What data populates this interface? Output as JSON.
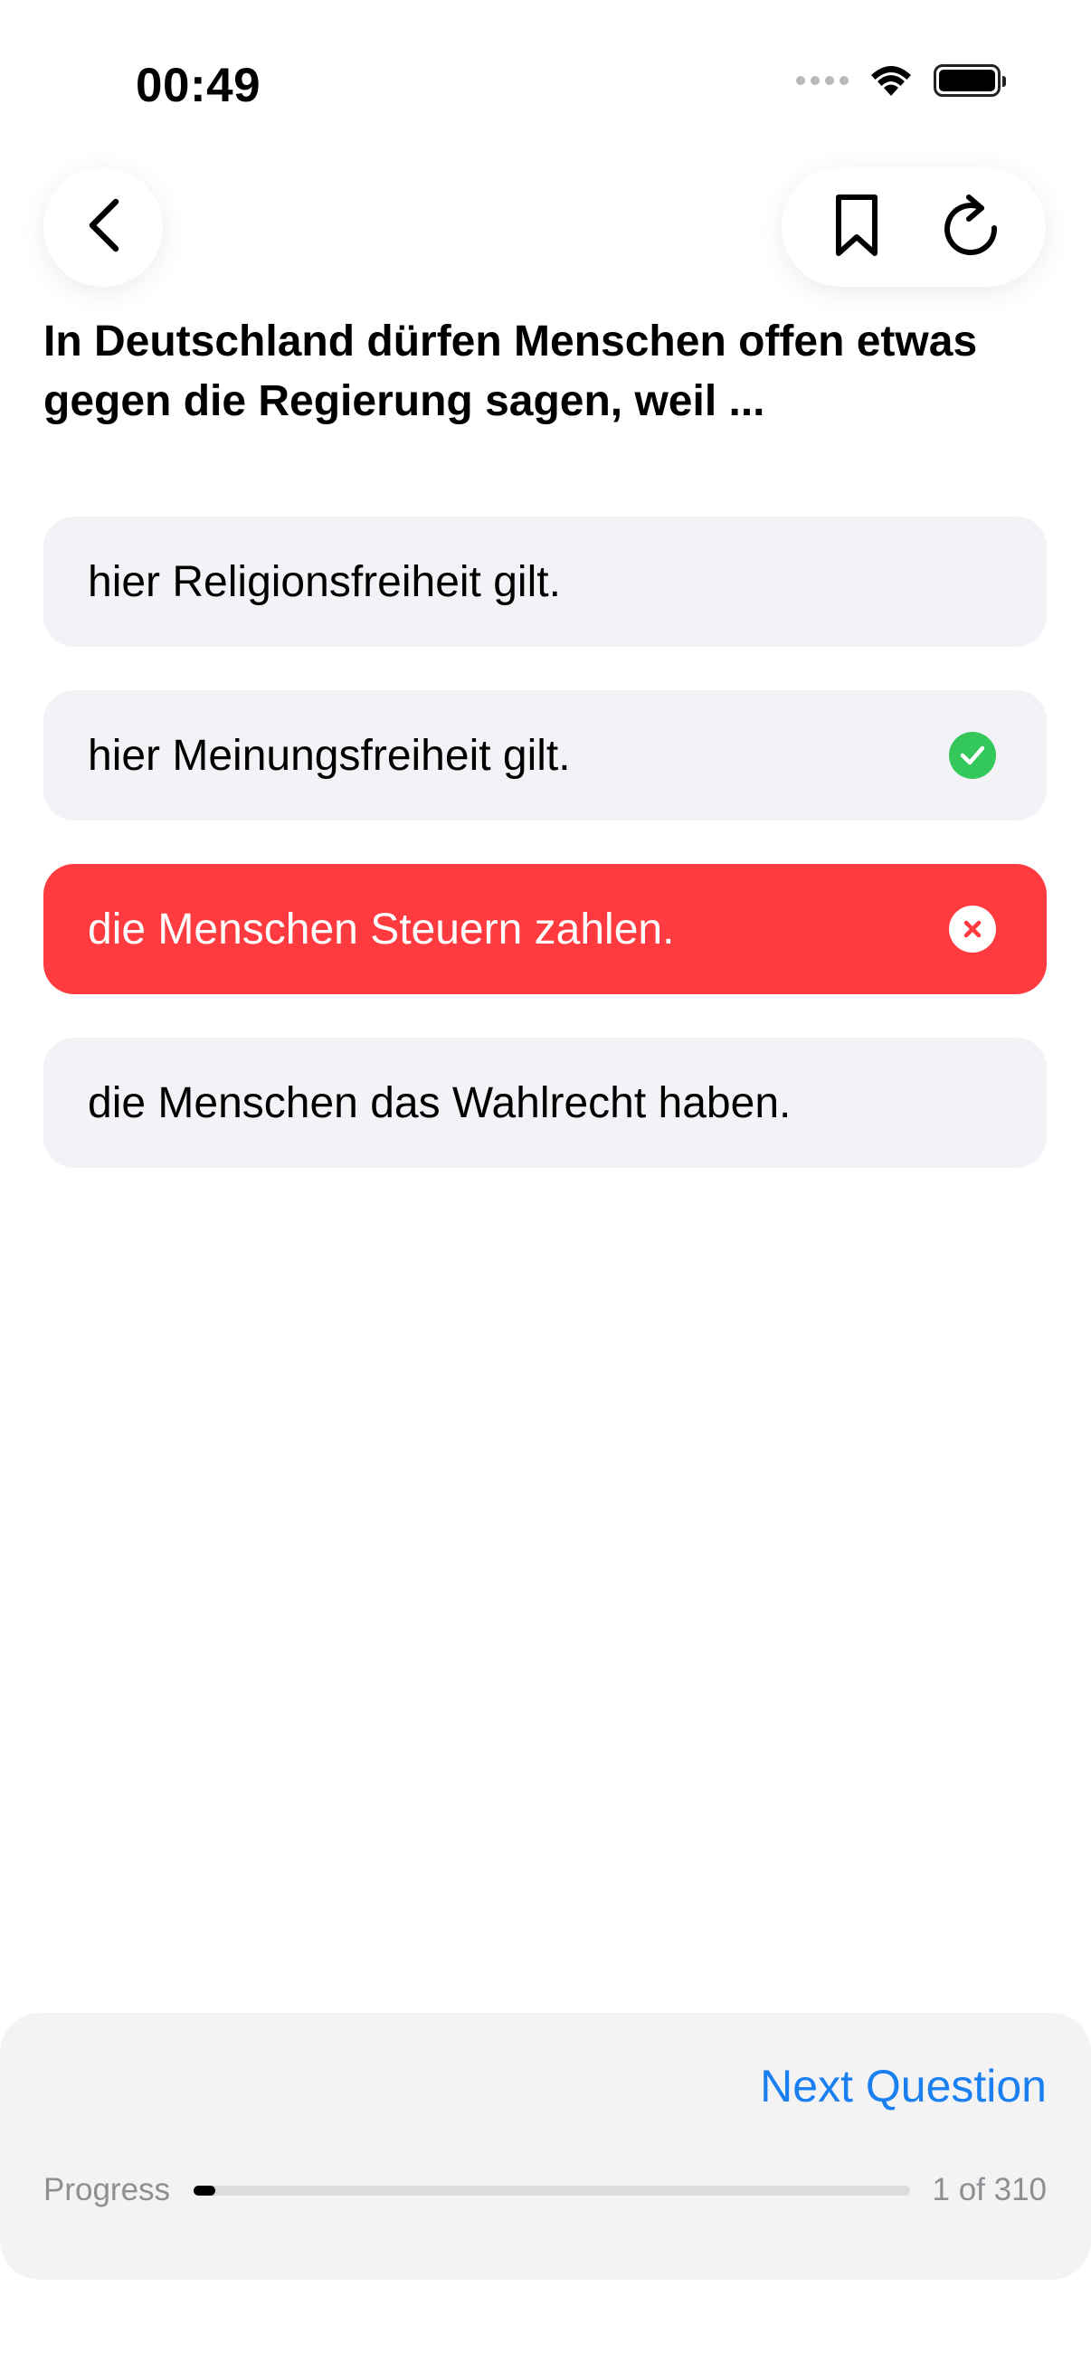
{
  "status_bar": {
    "time": "00:49"
  },
  "nav": {
    "back_icon": "chevron-left-icon",
    "bookmark_icon": "bookmark-icon",
    "restart_icon": "rotate-cw-icon"
  },
  "question": {
    "text": "In Deutschland dürfen Menschen offen etwas gegen die Regierung sagen, weil ..."
  },
  "answers": [
    {
      "label": "hier Religionsfreiheit gilt.",
      "state": "neutral"
    },
    {
      "label": "hier Meinungsfreiheit gilt.",
      "state": "correct"
    },
    {
      "label": "die Menschen Steuern zahlen.",
      "state": "wrong"
    },
    {
      "label": "die Menschen das Wahlrecht haben.",
      "state": "neutral"
    }
  ],
  "footer": {
    "next_label": "Next Question",
    "progress_label": "Progress",
    "progress_text": "1 of 310",
    "progress_current": 1,
    "progress_total": 310
  },
  "colors": {
    "accent": "#1a7ff0",
    "correct": "#34c759",
    "wrong": "#ff3b3f",
    "card": "#f2f2f7"
  }
}
